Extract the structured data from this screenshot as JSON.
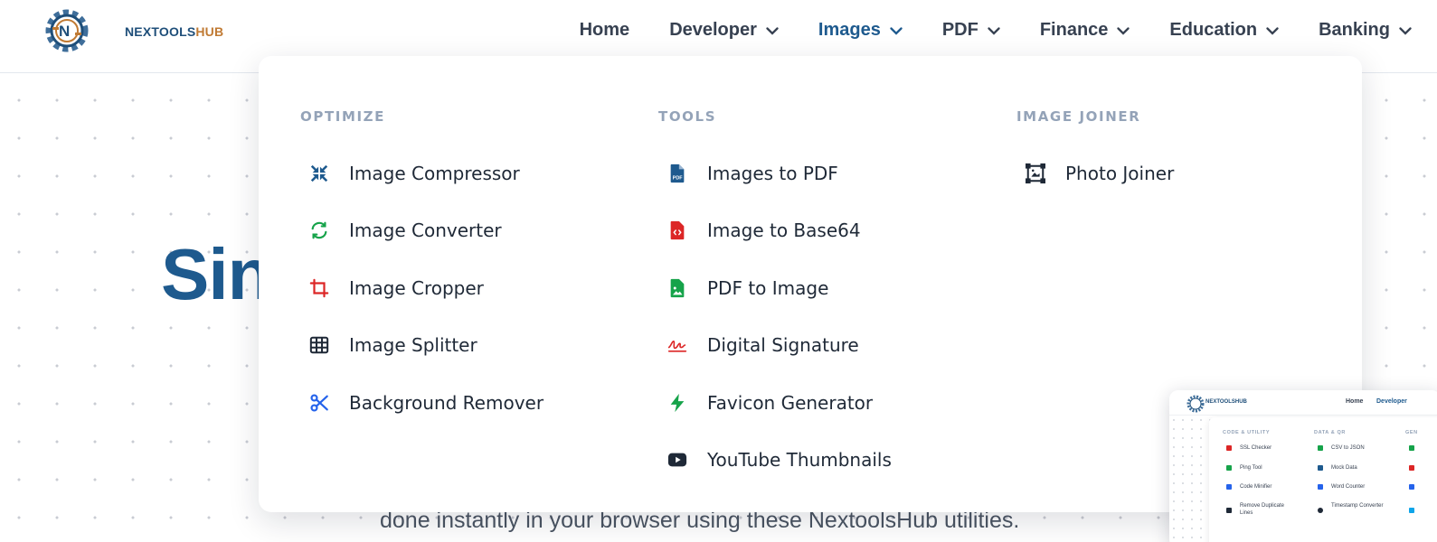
{
  "brand": {
    "name_part1": "NEXTOOLS",
    "name_part2": "HUB",
    "logo_icon": "gear-logo-icon",
    "primary_color": "#1e5a8e",
    "accent_color": "#c07a33"
  },
  "nav": {
    "items": [
      {
        "label": "Home",
        "has_dropdown": false
      },
      {
        "label": "Developer",
        "has_dropdown": true
      },
      {
        "label": "Images",
        "has_dropdown": true,
        "active": true
      },
      {
        "label": "PDF",
        "has_dropdown": true
      },
      {
        "label": "Finance",
        "has_dropdown": true
      },
      {
        "label": "Education",
        "has_dropdown": true
      },
      {
        "label": "Banking",
        "has_dropdown": true
      }
    ]
  },
  "hero": {
    "title_partial": "Sin",
    "subtitle_partial": "done instantly in your browser using these NextoolsHub utilities."
  },
  "mega_menu": {
    "columns": [
      {
        "title": "OPTIMIZE",
        "items": [
          {
            "label": "Image Compressor",
            "icon": "compress-icon",
            "icon_color": "#1e5a8e"
          },
          {
            "label": "Image Converter",
            "icon": "refresh-icon",
            "icon_color": "#16a34a"
          },
          {
            "label": "Image Cropper",
            "icon": "crop-icon",
            "icon_color": "#dc2626"
          },
          {
            "label": "Image Splitter",
            "icon": "grid-icon",
            "icon_color": "#1f2937"
          },
          {
            "label": "Background Remover",
            "icon": "scissors-icon",
            "icon_color": "#2563eb"
          }
        ]
      },
      {
        "title": "TOOLS",
        "items": [
          {
            "label": "Images to PDF",
            "icon": "pdf-file-icon",
            "icon_color": "#1e5a8e"
          },
          {
            "label": "Image to Base64",
            "icon": "code-file-icon",
            "icon_color": "#dc2626"
          },
          {
            "label": "PDF to Image",
            "icon": "image-file-icon",
            "icon_color": "#16a34a"
          },
          {
            "label": "Digital Signature",
            "icon": "signature-icon",
            "icon_color": "#dc2626"
          },
          {
            "label": "Favicon Generator",
            "icon": "bolt-icon",
            "icon_color": "#16a34a"
          },
          {
            "label": "YouTube Thumbnails",
            "icon": "youtube-icon",
            "icon_color": "#1f2937"
          }
        ]
      },
      {
        "title": "IMAGE JOINER",
        "items": [
          {
            "label": "Photo Joiner",
            "icon": "photo-frame-icon",
            "icon_color": "#1f2937"
          }
        ]
      }
    ]
  },
  "preview": {
    "logo_text": "NEXTOOLSHUB",
    "nav": [
      "Home",
      "Developer"
    ],
    "columns": [
      {
        "title": "CODE & UTILITY",
        "items": [
          "SSL Checker",
          "Ping Tool",
          "Code Minifier",
          "Remove Duplicate Lines"
        ]
      },
      {
        "title": "DATA & QR",
        "items": [
          "CSV to JSON",
          "Mock Data",
          "Word Counter",
          "Timestamp Converter"
        ]
      },
      {
        "title": "GEN",
        "items": []
      }
    ]
  }
}
